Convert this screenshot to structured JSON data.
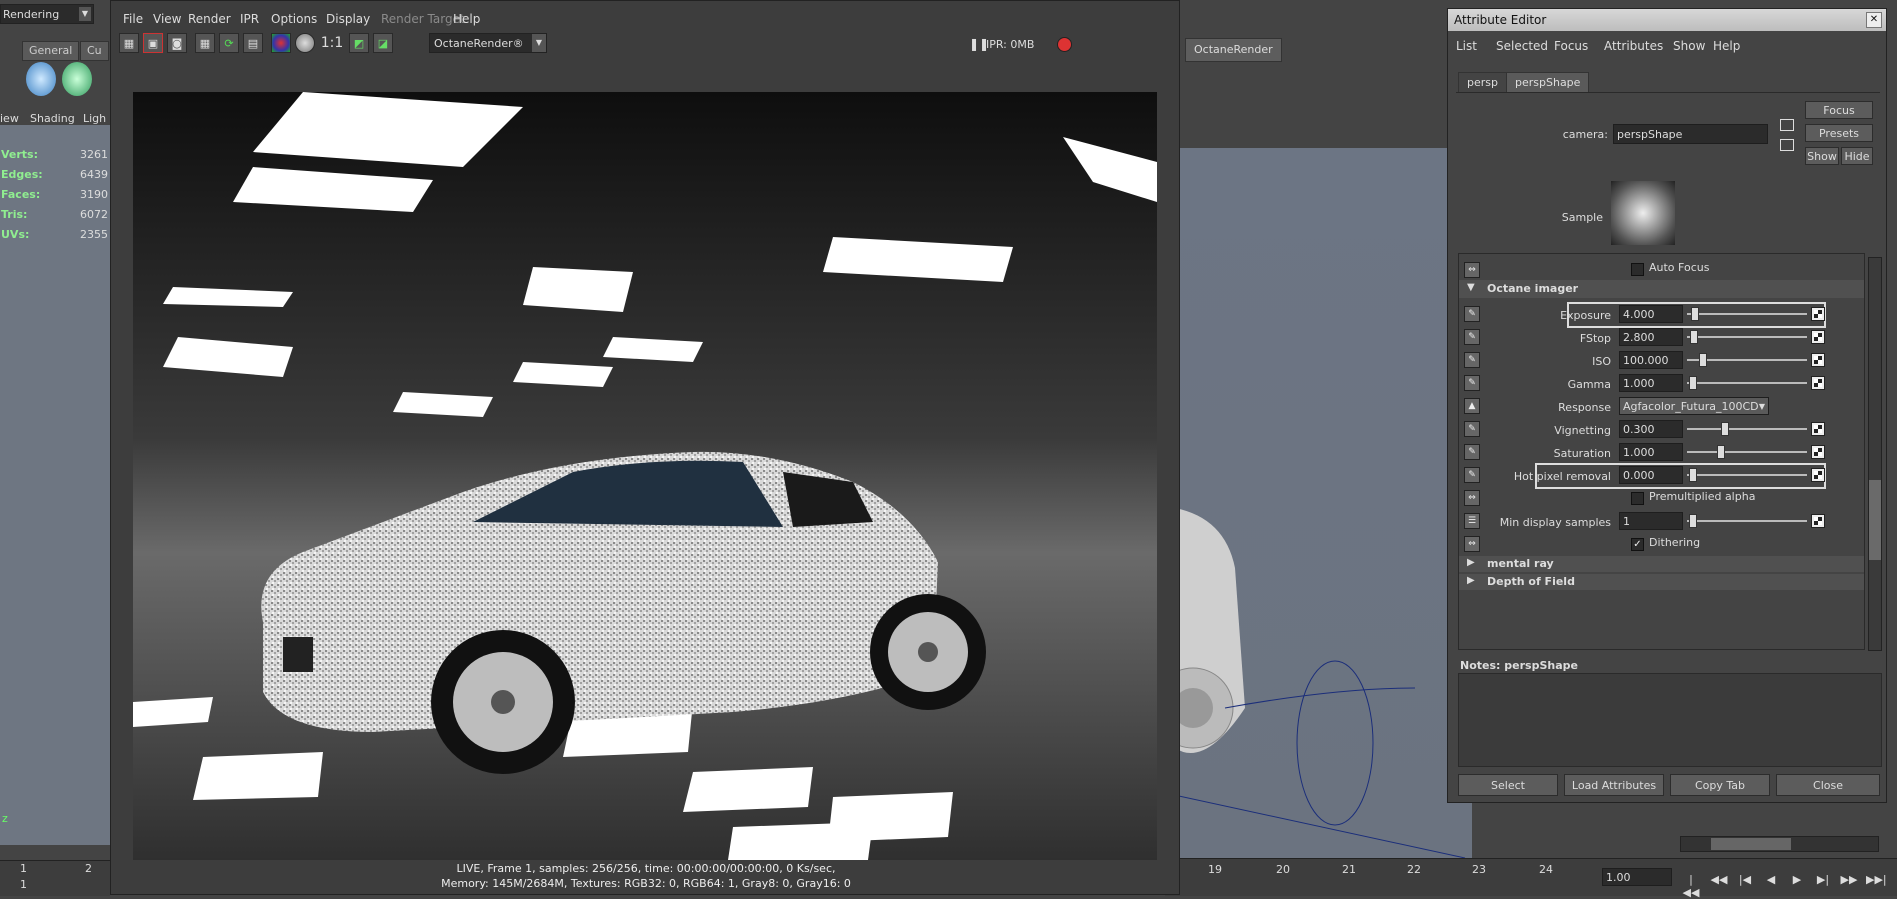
{
  "maya": {
    "mode_menu": "Rendering",
    "shelf_tabs": [
      "General",
      "Cu"
    ],
    "panel_menus": [
      "iew",
      "Shading",
      "Ligh"
    ],
    "hud": [
      {
        "label": "Verts:",
        "value": "3261"
      },
      {
        "label": "Edges:",
        "value": "6439"
      },
      {
        "label": "Faces:",
        "value": "3190"
      },
      {
        "label": "Tris:",
        "value": "6072"
      },
      {
        "label": "UVs:",
        "value": "2355"
      }
    ],
    "octane_tab": "OctaneRender",
    "timeline_left": [
      "1",
      "2"
    ],
    "timeline_left_frame": "1",
    "timeline_right": [
      "19",
      "20",
      "21",
      "22",
      "23",
      "24"
    ],
    "current_time": "1.00",
    "axis_label": "z"
  },
  "render_view": {
    "menus": [
      "File",
      "View",
      "Render",
      "IPR",
      "Options",
      "Display",
      "Render Target",
      "Help"
    ],
    "ratio_label": "1:1",
    "renderer": "OctaneRender®",
    "ipr_status": "IPR: 0MB",
    "status_line_1": "LIVE, Frame 1, samples: 256/256, time: 00:00:00/00:00:00, 0 Ks/sec,",
    "status_line_2": "Memory: 145M/2684M, Textures: RGB32: 0, RGB64: 1, Gray8: 0, Gray16: 0"
  },
  "attribute_editor": {
    "title": "Attribute Editor",
    "menus": [
      "List",
      "Selected",
      "Focus",
      "Attributes",
      "Show",
      "Help"
    ],
    "tabs": [
      "persp",
      "perspShape"
    ],
    "camera_label": "camera:",
    "camera_value": "perspShape",
    "focus_button": "Focus",
    "presets_button": "Presets",
    "show_button": "Show",
    "hide_button": "Hide",
    "sample_label": "Sample",
    "auto_focus_label": "Auto Focus",
    "section_octane_imager": "Octane imager",
    "rows": {
      "exposure": {
        "label": "Exposure",
        "value": "4.000",
        "level": 0.05
      },
      "fstop": {
        "label": "FStop",
        "value": "2.800",
        "level": 0.03
      },
      "iso": {
        "label": "ISO",
        "value": "100.000",
        "level": 0.1
      },
      "gamma": {
        "label": "Gamma",
        "value": "1.000",
        "level": 0.02
      },
      "response": {
        "label": "Response",
        "value": "Agfacolor_Futura_100CD"
      },
      "vignetting": {
        "label": "Vignetting",
        "value": "0.300",
        "level": 0.3
      },
      "saturation": {
        "label": "Saturation",
        "value": "1.000",
        "level": 0.25
      },
      "hot_pixel": {
        "label": "Hot pixel removal",
        "value": "0.000",
        "level": 0.0
      },
      "min_display": {
        "label": "Min display samples",
        "value": "1",
        "level": 0.0
      }
    },
    "premultiplied_label": "Premultiplied alpha",
    "dithering_label": "Dithering",
    "section_mental_ray": "mental ray",
    "section_dof": "Depth of Field",
    "notes_label": "Notes:  perspShape",
    "buttons": [
      "Select",
      "Load Attributes",
      "Copy Tab",
      "Close"
    ]
  }
}
